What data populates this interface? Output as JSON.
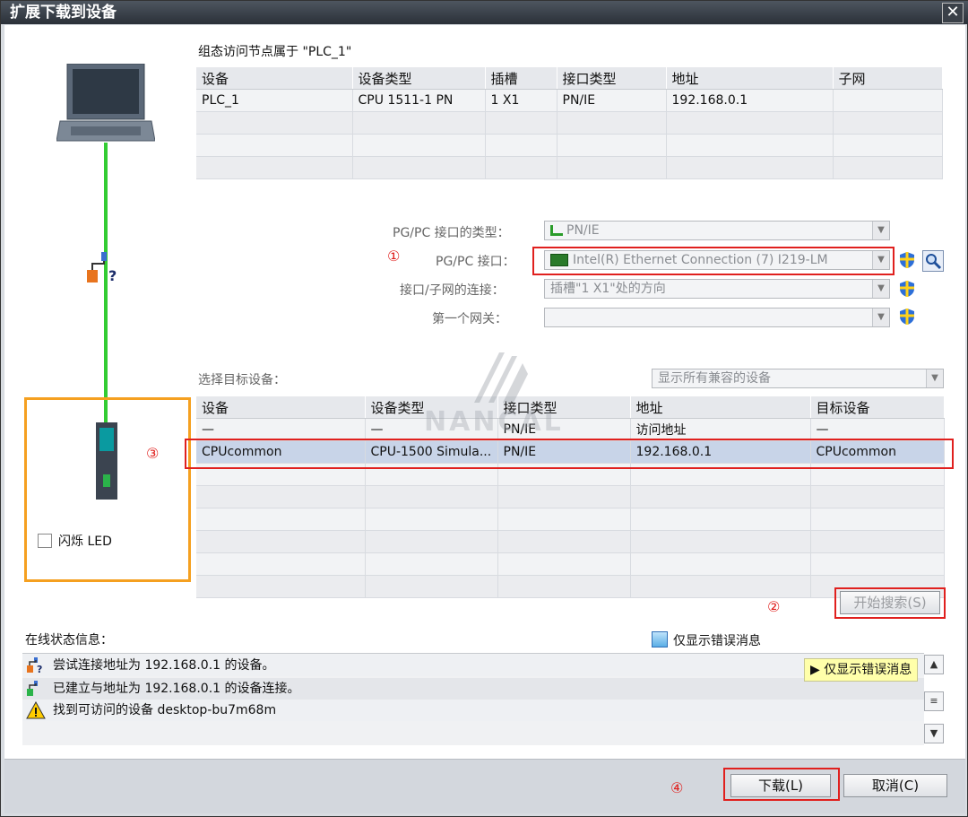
{
  "window": {
    "title": "扩展下载到设备",
    "close_symbol": "✕"
  },
  "top_section": {
    "caption": "组态访问节点属于 \"PLC_1\"",
    "headers": [
      "设备",
      "设备类型",
      "插槽",
      "接口类型",
      "地址",
      "子网"
    ],
    "rows": [
      [
        "PLC_1",
        "CPU 1511-1 PN",
        "1 X1",
        "PN/IE",
        "192.168.0.1",
        ""
      ]
    ]
  },
  "pgpc": {
    "type_label": "PG/PC 接口的类型：",
    "type_value": "PN/IE",
    "iface_label": "PG/PC 接口：",
    "iface_value": "Intel(R) Ethernet Connection (7) I219-LM",
    "conn_label": "接口/子网的连接：",
    "conn_value": "插槽\"1 X1\"处的方向",
    "gw_label": "第一个网关：",
    "gw_value": ""
  },
  "target": {
    "label": "选择目标设备：",
    "filter_value": "显示所有兼容的设备",
    "headers": [
      "设备",
      "设备类型",
      "接口类型",
      "地址",
      "目标设备"
    ],
    "rows": [
      [
        "—",
        "—",
        "PN/IE",
        "访问地址",
        "—"
      ],
      [
        "CPUcommon",
        "CPU-1500 Simula...",
        "PN/IE",
        "192.168.0.1",
        "CPUcommon"
      ]
    ]
  },
  "left_panel": {
    "flash_led_label": "闪烁 LED"
  },
  "watermark": {
    "brand": "NANCAL"
  },
  "annotations": {
    "one": "①",
    "two": "②",
    "three": "③",
    "four": "④"
  },
  "search_button": "开始搜索(S)",
  "status": {
    "label": "在线状态信息：",
    "only_errors_label": "仅显示错误消息",
    "tooltip": "仅显示错误消息",
    "messages": [
      "尝试连接地址为 192.168.0.1 的设备。",
      "已建立与地址为 192.168.0.1 的设备连接。",
      "找到可访问的设备 desktop-bu7m68m"
    ]
  },
  "buttons": {
    "download": "下载(L)",
    "cancel": "取消(C)"
  },
  "colors": {
    "accent_red": "#e0201e",
    "orange_frame": "#f5a020",
    "cable_green": "#33cc33",
    "tooltip_bg": "#ffffaa"
  }
}
